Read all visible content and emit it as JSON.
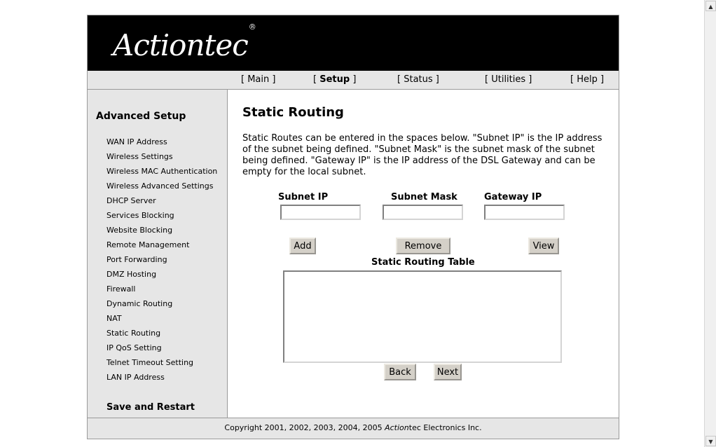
{
  "logo": {
    "text": "Actiontec",
    "mark": "®"
  },
  "nav": [
    {
      "label": "Main"
    },
    {
      "label": "Setup",
      "active": true
    },
    {
      "label": "Status"
    },
    {
      "label": "Utilities"
    },
    {
      "label": "Help"
    }
  ],
  "sidebar": {
    "heading": "Advanced Setup",
    "items": [
      {
        "label": "WAN IP Address"
      },
      {
        "label": "Wireless Settings"
      },
      {
        "label": "Wireless MAC Authentication"
      },
      {
        "label": "Wireless Advanced Settings"
      },
      {
        "label": "DHCP Server"
      },
      {
        "label": "Services Blocking"
      },
      {
        "label": "Website Blocking"
      },
      {
        "label": "Remote Management"
      },
      {
        "label": "Port Forwarding"
      },
      {
        "label": "DMZ Hosting"
      },
      {
        "label": "Firewall"
      },
      {
        "label": "Dynamic Routing"
      },
      {
        "label": "NAT"
      },
      {
        "label": "Static Routing"
      },
      {
        "label": "IP QoS Setting"
      },
      {
        "label": "Telnet Timeout Setting"
      },
      {
        "label": "LAN IP Address"
      }
    ],
    "save_label": "Save and Restart"
  },
  "main": {
    "title": "Static Routing",
    "description": "Static Routes can be entered in the spaces below. \"Subnet IP\" is the IP address of the subnet being defined. \"Subnet Mask\" is the subnet mask of the subnet being defined. \"Gateway IP\" is the IP address of the DSL Gateway and can be empty for the local subnet.",
    "fields": {
      "subnet_ip": {
        "label": "Subnet IP",
        "value": ""
      },
      "subnet_mask": {
        "label": "Subnet Mask",
        "value": ""
      },
      "gateway_ip": {
        "label": "Gateway IP",
        "value": ""
      }
    },
    "buttons": {
      "add": "Add",
      "remove": "Remove",
      "view": "View",
      "back": "Back",
      "next": "Next"
    },
    "table_title": "Static Routing Table"
  },
  "footer": {
    "prefix": "Copyright 2001, 2002, 2003, 2004, 2005 ",
    "brand": "Action",
    "suffix": "tec Electronics Inc."
  }
}
